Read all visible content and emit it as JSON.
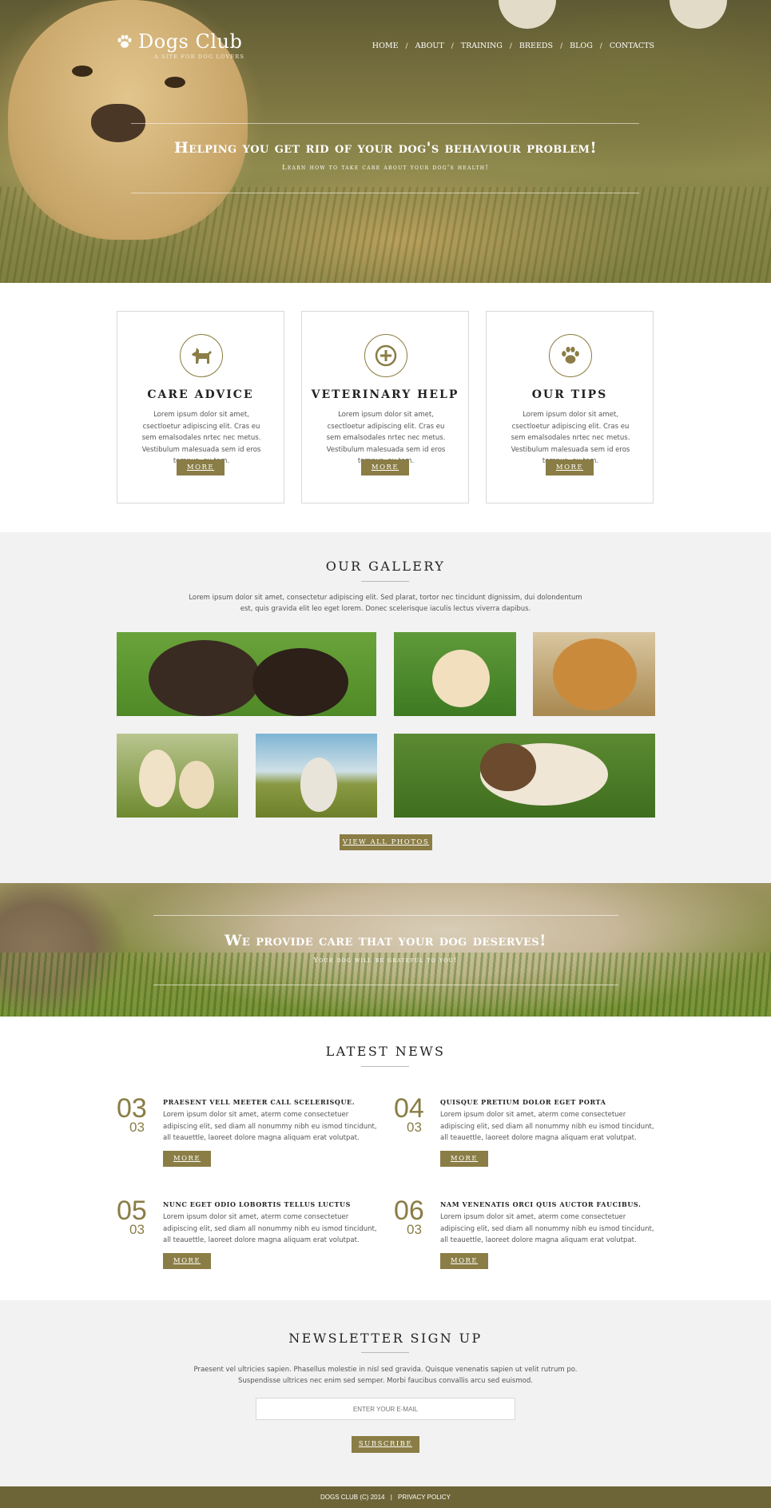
{
  "header": {
    "logo_title": "Dogs Club",
    "logo_subtitle": "A SITE FOR DOG LOVERS",
    "logo_icon": "paw-icon",
    "nav": [
      "HOME",
      "ABOUT",
      "TRAINING",
      "BREEDS",
      "BLOG",
      "CONTACTS"
    ]
  },
  "hero": {
    "title": "Helping you get rid of your dog's behaviour problem!",
    "subtitle": "Learn how to take care about your dog's health!"
  },
  "features": [
    {
      "icon": "dog-icon",
      "title": "CARE ADVICE",
      "text": "Lorem ipsum dolor sit amet, csectloetur adipiscing elit. Cras eu sem emalsodales nrtec nec metus. Vestibulum malesuada sem id eros tempus, eu tem.",
      "button": "MORE"
    },
    {
      "icon": "plus-circle-icon",
      "title": "VETERINARY HELP",
      "text": "Lorem ipsum dolor sit amet, csectloetur adipiscing elit. Cras eu sem emalsodales nrtec nec metus. Vestibulum malesuada sem id eros tempus, eu tem.",
      "button": "MORE"
    },
    {
      "icon": "paw-icon",
      "title": "OUR TIPS",
      "text": "Lorem ipsum dolor sit amet, csectloetur adipiscing elit. Cras eu sem emalsodales nrtec nec metus. Vestibulum malesuada sem id eros tempus, eu tem.",
      "button": "MORE"
    }
  ],
  "gallery": {
    "title": "OUR GALLERY",
    "text_line1": "Lorem ipsum dolor sit amet, consectetur adipiscing elit. Sed plarat, tortor nec tincidunt dignissim, dui dolondentum",
    "text_line2": "est, quis gravida elit leo eget lorem. Donec scelerisque iaculis lectus viverra dapibus.",
    "button": "VIEW ALL PHOTOS"
  },
  "banner": {
    "title": "We provide care that your dog deserves!",
    "subtitle": "Your dog will be grateful to you!"
  },
  "news": {
    "title": "LATEST NEWS",
    "items": [
      {
        "num": "03",
        "day": "03",
        "title": "PRAESENT VELL  MEETER CALL SCELERISQUE.",
        "text": "Lorem ipsum dolor sit amet, aterm come consectetuer adipiscing elit, sed diam all nonummy nibh eu ismod  tincidunt, all teauettle, laoreet dolore magna aliquam erat volutpat.",
        "button": "MORE"
      },
      {
        "num": "04",
        "day": "03",
        "title": "QUISQUE PRETIUM DOLOR EGET PORTA",
        "text": "Lorem ipsum dolor sit amet, aterm come consectetuer adipiscing elit, sed diam all nonummy nibh eu ismod  tincidunt, all teauettle, laoreet dolore magna aliquam erat volutpat.",
        "button": "MORE"
      },
      {
        "num": "05",
        "day": "03",
        "title": "NUNC EGET ODIO LOBORTIS TELLUS LUCTUS",
        "text": "Lorem ipsum dolor sit amet, aterm come consectetuer adipiscing elit, sed diam all nonummy nibh eu ismod  tincidunt, all teauettle, laoreet dolore magna aliquam erat volutpat.",
        "button": "MORE"
      },
      {
        "num": "06",
        "day": "03",
        "title": "NAM VENENATIS ORCI QUIS AUCTOR FAUCIBUS.",
        "text": "Lorem ipsum dolor sit amet, aterm come consectetuer adipiscing elit, sed diam all nonummy nibh eu ismod  tincidunt, all teauettle, laoreet dolore magna aliquam erat volutpat.",
        "button": "MORE"
      }
    ]
  },
  "newsletter": {
    "title": "NEWSLETTER SIGN UP",
    "text_line1": "Praesent vel ultricies sapien. Phasellus molestie in nisl sed gravida. Quisque venenatis sapien ut velit rutrum po.",
    "text_line2": "Suspendisse ultrices nec enim sed semper. Morbi faucibus convallis arcu sed euismod.",
    "email_placeholder": "ENTER YOUR E-MAIL",
    "button": "SUBSCRIBE"
  },
  "footer": {
    "copyright": "DOGS CLUB (C) 2014",
    "separator": "|",
    "privacy": "PRIVACY POLICY"
  },
  "colors": {
    "accent": "#8a7d45",
    "footer": "#6d6437",
    "section_bg": "#f2f2f2"
  }
}
